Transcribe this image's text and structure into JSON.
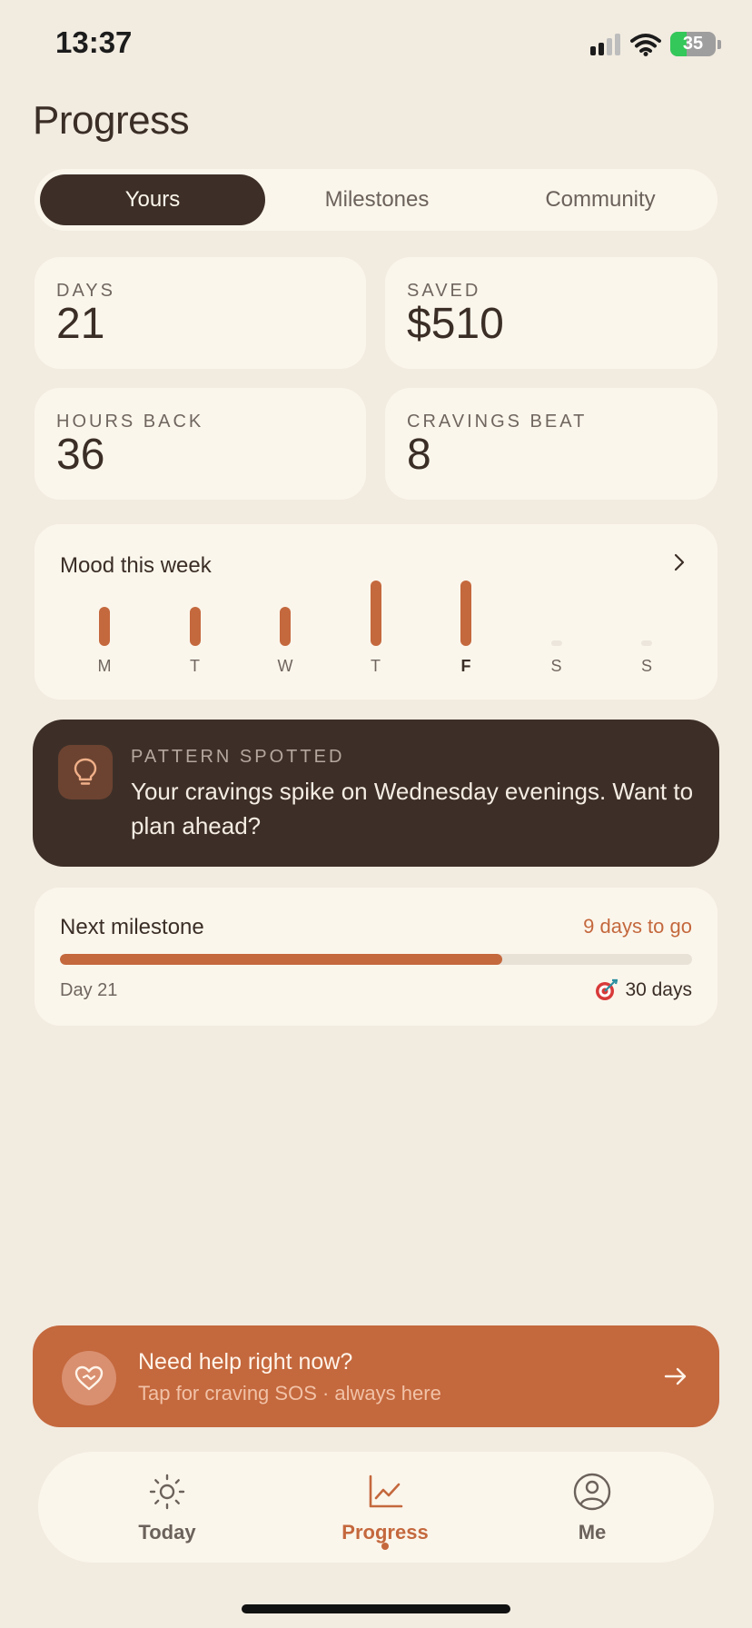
{
  "status_bar": {
    "time": "13:37",
    "battery": "35"
  },
  "page": {
    "title": "Progress"
  },
  "tabs": [
    {
      "label": "Yours",
      "active": true
    },
    {
      "label": "Milestones",
      "active": false
    },
    {
      "label": "Community",
      "active": false
    }
  ],
  "stats": [
    {
      "label": "DAYS",
      "value": "21"
    },
    {
      "label": "SAVED",
      "value": "$510"
    },
    {
      "label": "HOURS BACK",
      "value": "36"
    },
    {
      "label": "CRAVINGS BEAT",
      "value": "8"
    }
  ],
  "mood": {
    "title": "Mood this week",
    "scale_max": 5,
    "days": [
      {
        "label": "M",
        "level": 3
      },
      {
        "label": "T",
        "level": 3
      },
      {
        "label": "W",
        "level": 3
      },
      {
        "label": "T",
        "level": 5
      },
      {
        "label": "F",
        "level": 5,
        "current": true
      },
      {
        "label": "S",
        "level": 0
      },
      {
        "label": "S",
        "level": 0
      }
    ]
  },
  "pattern": {
    "label": "PATTERN SPOTTED",
    "text": "Your cravings spike on Wednesday evenings. Want to plan ahead?",
    "icon": "lightbulb-icon"
  },
  "milestone": {
    "title": "Next milestone",
    "remaining": "9 days to go",
    "start_label": "Day 21",
    "goal_label": "30 days",
    "progress": 0.7,
    "goal_icon": "target-icon"
  },
  "sos": {
    "title": "Need help right now?",
    "subtitle": "Tap for craving SOS · always here",
    "icon": "heart-handshake-icon"
  },
  "nav": [
    {
      "label": "Today",
      "icon": "sun-icon",
      "active": false
    },
    {
      "label": "Progress",
      "icon": "chart-icon",
      "active": true
    },
    {
      "label": "Me",
      "icon": "profile-icon",
      "active": false
    }
  ],
  "colors": {
    "background": "#F2EBE0",
    "card": "#FBF6EC",
    "accent": "#C4683D",
    "dark": "#3D2F28"
  }
}
